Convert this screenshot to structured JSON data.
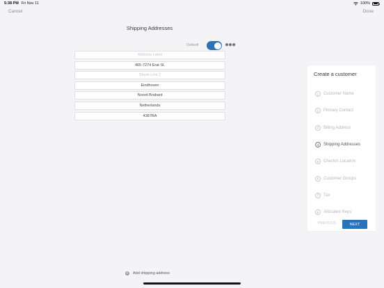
{
  "status_bar": {
    "time": "5:38 PM",
    "date": "Fri Nov 11",
    "battery": "100%"
  },
  "nav": {
    "cancel_label": "Cancel",
    "done_label": "Done"
  },
  "page": {
    "title": "Shipping Addresses",
    "default_label": "Default",
    "default_on": true
  },
  "address_fields": [
    {
      "name": "address-label-field",
      "value": "",
      "placeholder": "Address Label"
    },
    {
      "name": "street-line-1-field",
      "value": "465-7274 Erat St.",
      "placeholder": ""
    },
    {
      "name": "street-line-2-field",
      "value": "",
      "placeholder": "Street Line 2"
    },
    {
      "name": "city-field",
      "value": "Eindhoven",
      "placeholder": ""
    },
    {
      "name": "state-field",
      "value": "Noord Brabant",
      "placeholder": ""
    },
    {
      "name": "country-field",
      "value": "Netherlands",
      "placeholder": ""
    },
    {
      "name": "postal-code-field",
      "value": "4387RA",
      "placeholder": ""
    }
  ],
  "wizard": {
    "title": "Create a customer",
    "steps": [
      {
        "num": "1",
        "label": "Customer Name"
      },
      {
        "num": "2",
        "label": "Primary Contact"
      },
      {
        "num": "3",
        "label": "Billing Address"
      },
      {
        "num": "4",
        "label": "Shipping Addresses"
      },
      {
        "num": "5",
        "label": "Checkin Location"
      },
      {
        "num": "6",
        "label": "Customer Groups"
      },
      {
        "num": "7",
        "label": "Tax"
      },
      {
        "num": "8",
        "label": "Allocated Reps"
      }
    ],
    "active_step": 4,
    "previous_label": "PREVIOUS",
    "next_label": "NEXT"
  },
  "footer": {
    "add_label": "Add shipping address"
  },
  "colors": {
    "accent": "#2b73b8",
    "background": "#f4f4f6"
  }
}
